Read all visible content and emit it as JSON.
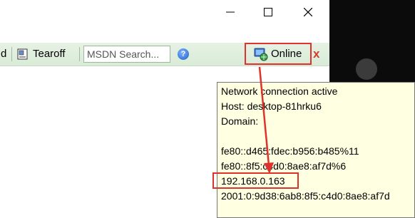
{
  "window": {
    "controls": [
      "minimize",
      "maximize",
      "close"
    ]
  },
  "toolbar": {
    "partial_label": "d",
    "tearoff_label": "Tearoff",
    "search_value": "MSDN Search...",
    "help_glyph": "?",
    "online_label": "Online",
    "close_glyph": "x"
  },
  "tooltip": {
    "status": "Network connection active",
    "host": "Host: desktop-81hrku6",
    "domain": "Domain:",
    "addresses": [
      "fe80::d465:fdec:b956:b485%11",
      "fe80::8f5:c4d0:8ae8:af7d%6",
      "192.168.0.163",
      "2001:0:9d38:6ab8:8f5:c4d0:8ae8:af7d"
    ]
  },
  "colors": {
    "highlight": "#e0322c",
    "toolbar_bg": "#dcedda",
    "tooltip_bg": "#ffffe1"
  }
}
